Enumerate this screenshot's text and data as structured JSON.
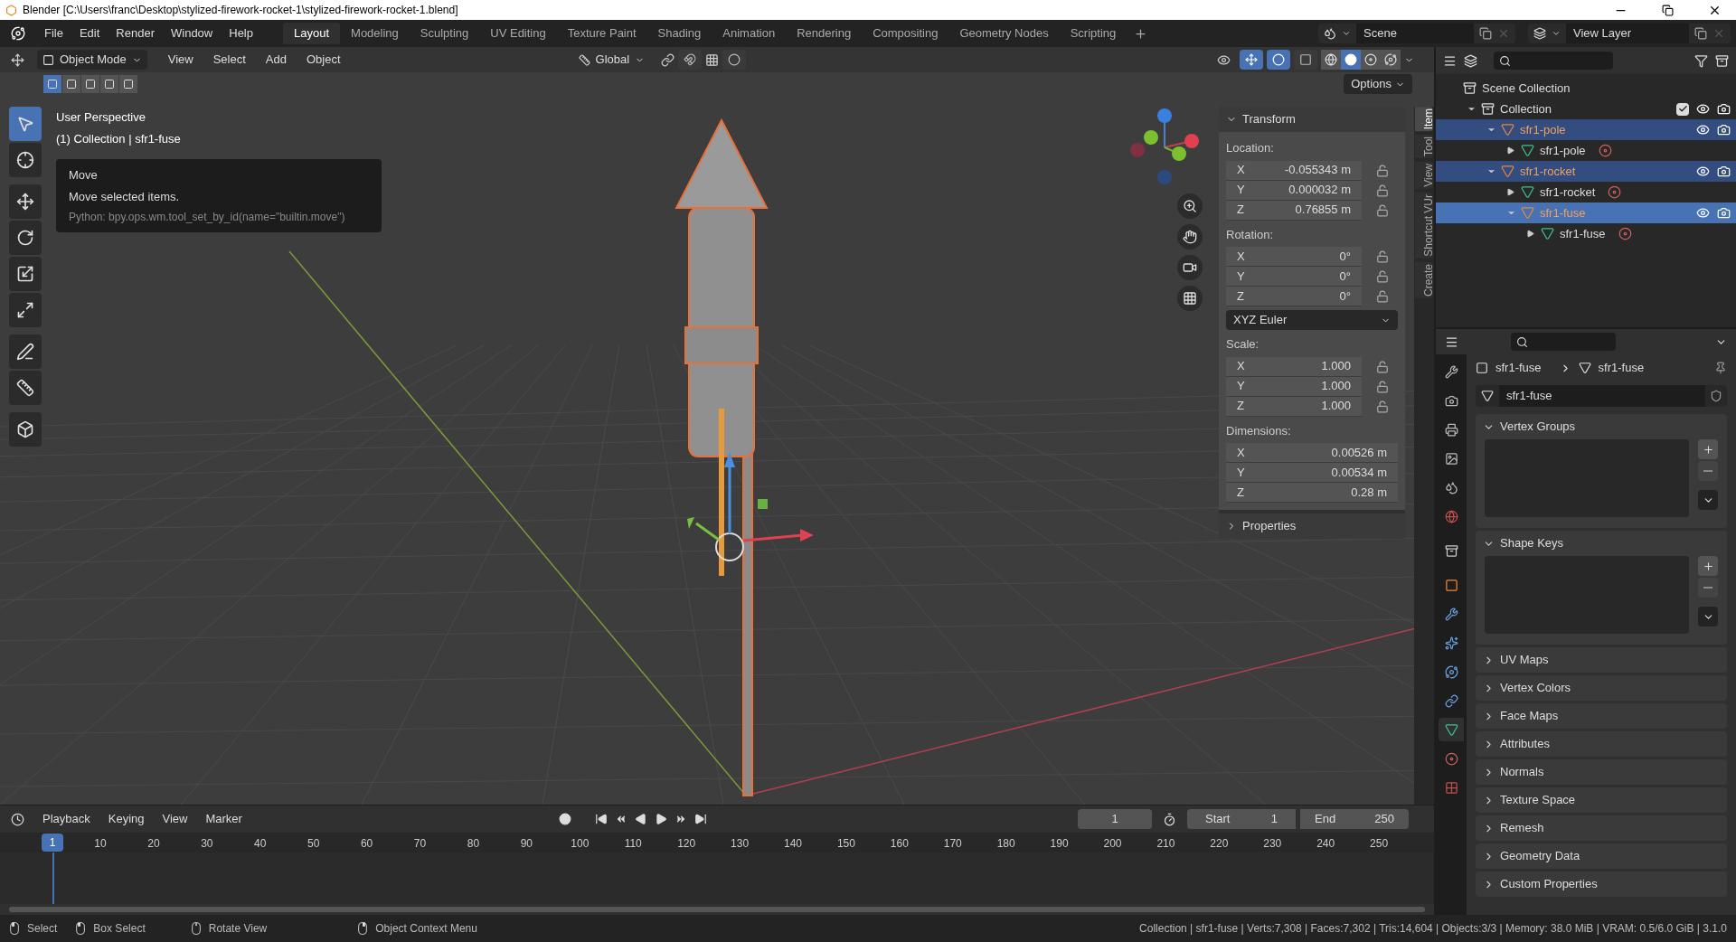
{
  "window": {
    "title": "Blender [C:\\Users\\franc\\Desktop\\stylized-firework-rocket-1\\stylized-firework-rocket-1.blend]"
  },
  "menu": [
    "File",
    "Edit",
    "Render",
    "Window",
    "Help"
  ],
  "workspaces": [
    {
      "label": "Layout",
      "selected": true
    },
    {
      "label": "Modeling",
      "selected": false
    },
    {
      "label": "Sculpting",
      "selected": false
    },
    {
      "label": "UV Editing",
      "selected": false
    },
    {
      "label": "Texture Paint",
      "selected": false
    },
    {
      "label": "Shading",
      "selected": false
    },
    {
      "label": "Animation",
      "selected": false
    },
    {
      "label": "Rendering",
      "selected": false
    },
    {
      "label": "Compositing",
      "selected": false
    },
    {
      "label": "Geometry Nodes",
      "selected": false
    },
    {
      "label": "Scripting",
      "selected": false
    }
  ],
  "scene": "Scene",
  "view_layer": "View Layer",
  "viewport": {
    "mode": "Object Mode",
    "menus": [
      "View",
      "Select",
      "Add",
      "Object"
    ],
    "orientation": "Global",
    "snap": {
      "on": false
    },
    "proportional": {
      "on": false
    },
    "gizmos": {
      "on": true
    },
    "overlays": {
      "on": true
    },
    "xray": {
      "on": false
    },
    "shading": [
      {
        "kind": "wireframe",
        "selected": false
      },
      {
        "kind": "solid",
        "selected": true
      },
      {
        "kind": "material",
        "selected": false
      },
      {
        "kind": "rendered",
        "selected": false
      }
    ],
    "select_modes": [
      {
        "selected": true
      },
      {
        "selected": false
      },
      {
        "selected": false
      },
      {
        "selected": false
      },
      {
        "selected": false
      }
    ],
    "options": "Options",
    "tools": [
      {
        "kind": "select",
        "selected": true
      },
      {
        "kind": "cursor",
        "selected": false
      },
      {
        "kind": "move",
        "selected": false
      },
      {
        "kind": "rotate",
        "selected": false
      },
      {
        "kind": "scale",
        "selected": false
      },
      {
        "kind": "transform",
        "selected": false
      },
      {
        "kind": "annotate",
        "selected": false
      },
      {
        "kind": "measure",
        "selected": false
      },
      {
        "kind": "add_cube",
        "selected": false
      }
    ],
    "perspective": "User Perspective",
    "context": "(1) Collection | sfr1-fuse",
    "tooltip": {
      "title": "Move",
      "description": "Move selected items.",
      "python": "Python: bpy.ops.wm.tool_set_by_id(name=\"builtin.move\")"
    }
  },
  "n_panel": {
    "tabs": [
      {
        "label": "Item",
        "selected": true
      },
      {
        "label": "Tool",
        "selected": false
      },
      {
        "label": "View",
        "selected": false
      },
      {
        "label": "Shortcut VUr",
        "selected": false
      },
      {
        "label": "Create",
        "selected": false
      }
    ],
    "transform": {
      "title": "Transform",
      "expanded": true,
      "items": [
        {
          "kind": "group",
          "label": "Location:",
          "rows": [
            {
              "axis": "X",
              "value": "-0.055343 m",
              "locked": false
            },
            {
              "axis": "Y",
              "value": "0.000032 m",
              "locked": false
            },
            {
              "axis": "Z",
              "value": "0.76855 m",
              "locked": false
            }
          ]
        },
        {
          "kind": "group",
          "label": "Rotation:",
          "rows": [
            {
              "axis": "X",
              "value": "0°",
              "locked": false
            },
            {
              "axis": "Y",
              "value": "0°",
              "locked": false
            },
            {
              "axis": "Z",
              "value": "0°",
              "locked": false
            }
          ]
        },
        {
          "kind": "dropdown",
          "value": "XYZ Euler"
        },
        {
          "kind": "group",
          "label": "Scale:",
          "rows": [
            {
              "axis": "X",
              "value": "1.000",
              "locked": false
            },
            {
              "axis": "Y",
              "value": "1.000",
              "locked": false
            },
            {
              "axis": "Z",
              "value": "1.000",
              "locked": false
            }
          ]
        },
        {
          "kind": "group",
          "label": "Dimensions:",
          "rows": [
            {
              "axis": "X",
              "value": "0.00526 m"
            },
            {
              "axis": "Y",
              "value": "0.00534 m"
            },
            {
              "axis": "Z",
              "value": "0.28 m"
            }
          ]
        }
      ]
    },
    "properties": {
      "title": "Properties",
      "expanded": false
    }
  },
  "outliner": {
    "root": "Scene Collection",
    "tree": [
      {
        "name": "Collection",
        "kind": "collection",
        "expanded": true,
        "checked": true,
        "visible": true,
        "selected": false,
        "active": false,
        "children": [
          {
            "name": "sfr1-pole",
            "kind": "object",
            "expanded": true,
            "visible": true,
            "selected": true,
            "active": false,
            "children": [
              {
                "name": "sfr1-pole",
                "kind": "mesh",
                "expanded": false,
                "selected": false,
                "active": false
              }
            ]
          },
          {
            "name": "sfr1-rocket",
            "kind": "object",
            "expanded": true,
            "visible": true,
            "selected": true,
            "active": false,
            "children": [
              {
                "name": "sfr1-rocket",
                "kind": "mesh",
                "expanded": false,
                "selected": false,
                "active": false
              },
              {
                "name": "sfr1-fuse",
                "kind": "object",
                "expanded": true,
                "visible": true,
                "selected": true,
                "active": true,
                "children": [
                  {
                    "name": "sfr1-fuse",
                    "kind": "mesh",
                    "expanded": false,
                    "selected": false,
                    "active": false
                  }
                ]
              }
            ]
          }
        ]
      }
    ]
  },
  "properties": {
    "tabs": [
      {
        "kind": "tool",
        "selected": false
      },
      {
        "kind": "render",
        "selected": false
      },
      {
        "kind": "output",
        "selected": false
      },
      {
        "kind": "view_layer",
        "selected": false
      },
      {
        "kind": "scene",
        "selected": false
      },
      {
        "kind": "world",
        "selected": false
      },
      {
        "kind": "collection",
        "selected": false
      },
      {
        "kind": "object",
        "selected": false
      },
      {
        "kind": "modifiers",
        "selected": false
      },
      {
        "kind": "particles",
        "selected": false
      },
      {
        "kind": "physics",
        "selected": false
      },
      {
        "kind": "constraints",
        "selected": false
      },
      {
        "kind": "data",
        "selected": true
      },
      {
        "kind": "material",
        "selected": false
      },
      {
        "kind": "texture",
        "selected": false
      }
    ],
    "breadcrumb": [
      "sfr1-fuse",
      "sfr1-fuse"
    ],
    "data_name": "sfr1-fuse",
    "panels": [
      {
        "title": "Vertex Groups",
        "expanded": true
      },
      {
        "title": "Shape Keys",
        "expanded": true
      },
      {
        "title": "UV Maps",
        "expanded": false
      },
      {
        "title": "Vertex Colors",
        "expanded": false
      },
      {
        "title": "Face Maps",
        "expanded": false
      },
      {
        "title": "Attributes",
        "expanded": false
      },
      {
        "title": "Normals",
        "expanded": false
      },
      {
        "title": "Texture Space",
        "expanded": false
      },
      {
        "title": "Remesh",
        "expanded": false
      },
      {
        "title": "Geometry Data",
        "expanded": false
      },
      {
        "title": "Custom Properties",
        "expanded": false
      }
    ]
  },
  "timeline": {
    "menus": [
      "Playback",
      "Keying",
      "View",
      "Marker"
    ],
    "current_frame": "1",
    "start_label": "Start",
    "start": "1",
    "end_label": "End",
    "end": "250",
    "playhead": "1",
    "ticks": [
      "10",
      "20",
      "30",
      "40",
      "50",
      "60",
      "70",
      "80",
      "90",
      "100",
      "110",
      "120",
      "130",
      "140",
      "150",
      "160",
      "170",
      "180",
      "190",
      "200",
      "210",
      "220",
      "230",
      "240",
      "250"
    ]
  },
  "status": {
    "hints": [
      {
        "kind": "left",
        "label": "Select"
      },
      {
        "kind": "drag",
        "label": "Box Select"
      },
      {
        "kind": "middle",
        "label": "Rotate View"
      },
      {
        "kind": "right",
        "label": "Object Context Menu"
      }
    ],
    "stats": "Collection | sfr1-fuse | Verts:7,308 | Faces:7,302 | Tris:14,604 | Objects:3/3 | Memory: 38.0 MiB | VRAM: 0.5/6.0 GiB | 3.1.0"
  }
}
